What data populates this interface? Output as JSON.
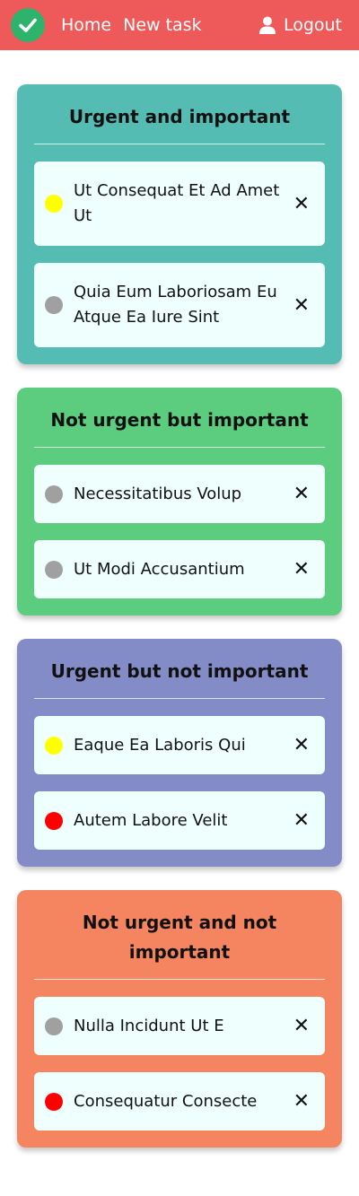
{
  "nav": {
    "home": "Home",
    "new_task": "New task",
    "logout": "Logout",
    "logo_icon": "check-circle-icon",
    "user_icon": "user-icon",
    "bg_color": "#ee5a5a"
  },
  "quadrants": [
    {
      "title": "Urgent and important",
      "color": "#55bcb3",
      "tasks": [
        {
          "label": "Ut Consequat Et Ad Amet Ut",
          "status_color": "#ffff00"
        },
        {
          "label": "Quia Eum Laboriosam Eu Atque Ea Iure Sint",
          "status_color": "#a0a0a0"
        }
      ]
    },
    {
      "title": "Not urgent but important",
      "color": "#5ccd7e",
      "tasks": [
        {
          "label": "Necessitatibus Volup",
          "status_color": "#a0a0a0"
        },
        {
          "label": "Ut Modi Accusantium",
          "status_color": "#a0a0a0"
        }
      ]
    },
    {
      "title": "Urgent but not important",
      "color": "#838cc6",
      "tasks": [
        {
          "label": "Eaque Ea Laboris Qui",
          "status_color": "#ffff00"
        },
        {
          "label": "Autem Labore Velit",
          "status_color": "#ff0000"
        }
      ]
    },
    {
      "title": "Not urgent and not important",
      "color": "#f58460",
      "tasks": [
        {
          "label": "Nulla Incidunt Ut E",
          "status_color": "#a0a0a0"
        },
        {
          "label": "Consequatur Consecte",
          "status_color": "#ff0000"
        }
      ]
    }
  ],
  "delete_symbol": "✕"
}
